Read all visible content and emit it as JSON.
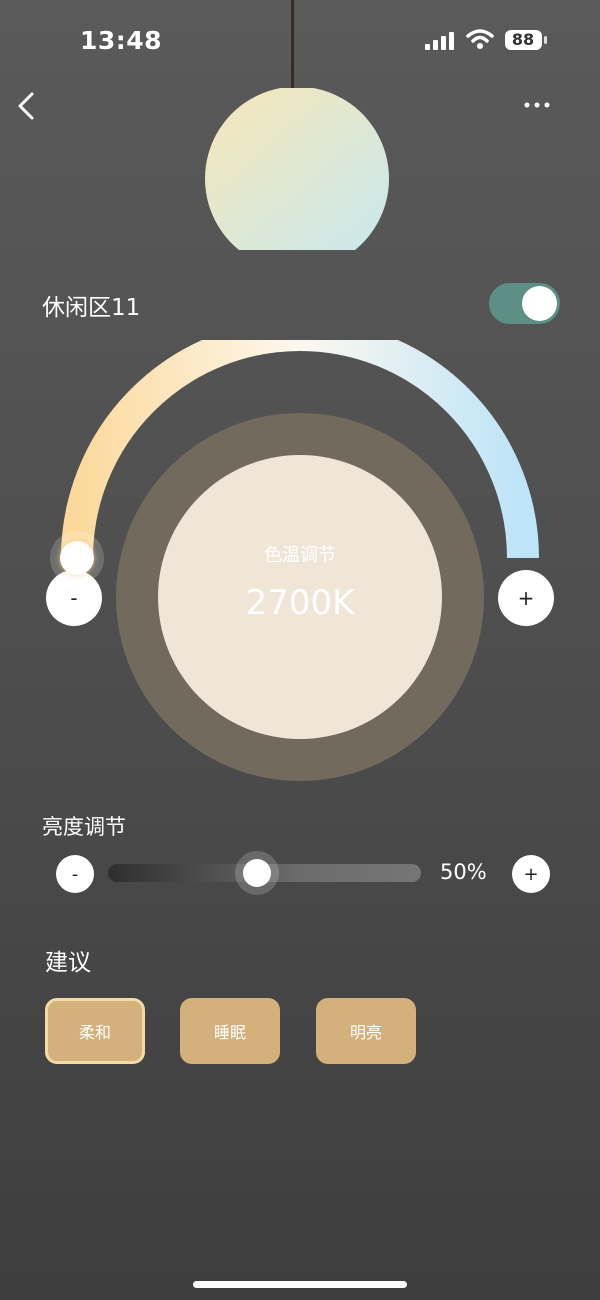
{
  "status_bar": {
    "time": "13:48",
    "battery": "88"
  },
  "device": {
    "name": "休闲区11",
    "power_on": true
  },
  "color_temp": {
    "title": "色温调节",
    "value": "2700K",
    "minus": "-",
    "plus": "+"
  },
  "brightness": {
    "label": "亮度调节",
    "value": "50%",
    "level": 0.5,
    "minus": "-",
    "plus": "+"
  },
  "suggestions": {
    "title": "建议",
    "items": [
      {
        "label": "柔和",
        "selected": true
      },
      {
        "label": "睡眠",
        "selected": false
      },
      {
        "label": "明亮",
        "selected": false
      }
    ]
  },
  "icons": {
    "back": "chevron-left-icon",
    "more": "more-horizontal-icon",
    "signal": "cellular-signal-icon",
    "wifi": "wifi-icon",
    "battery": "battery-icon"
  },
  "colors": {
    "toggle_on": "#5e8f86",
    "chip": "#d4b07a",
    "arc_warm": "#fcd99b",
    "arc_cool": "#bde4f8"
  }
}
